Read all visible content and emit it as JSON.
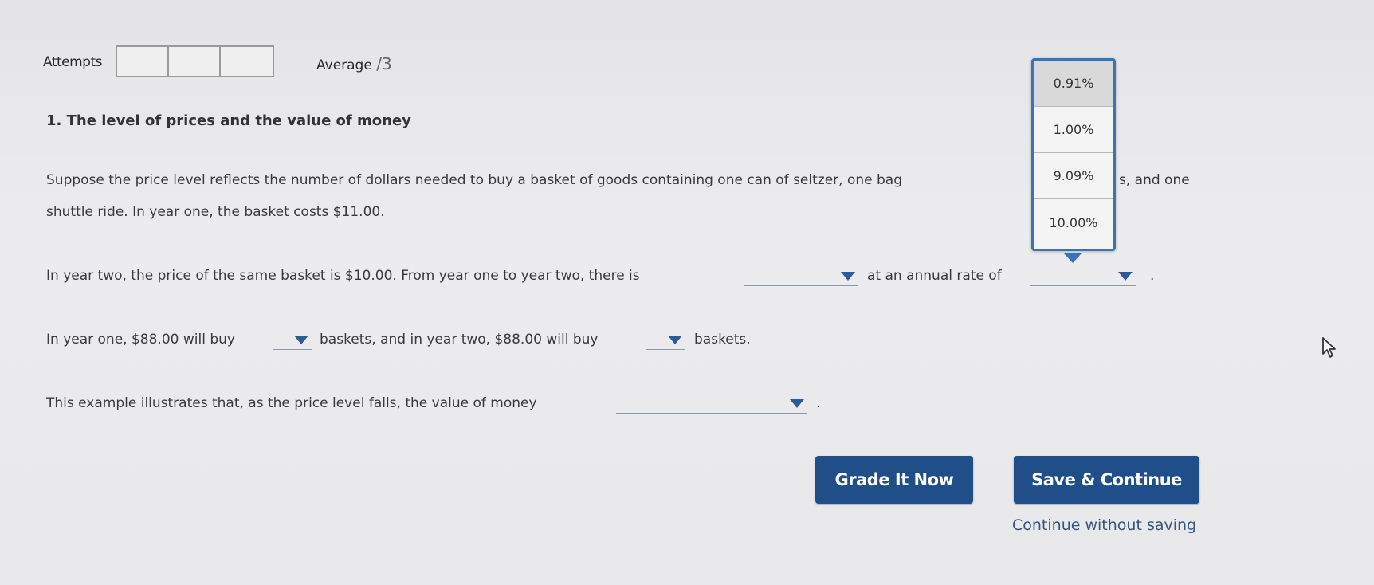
{
  "attempts": {
    "label": "Attempts",
    "box_count": 3
  },
  "average": {
    "label": "Average",
    "slash": "/",
    "value": "3"
  },
  "question": {
    "title": "1. The level of prices and the value of money",
    "intro_line1_a": "Suppose the price level reflects the number of dollars needed to buy a basket of goods containing one can of seltzer, one bag",
    "intro_line1_b": "s, and one",
    "intro_line2": "shuttle ride. In year one, the basket costs $11.00.",
    "year_two_text": "In year two, the price of the same basket is $10.00. From year one to year two, there is",
    "annual_rate_text": "at an annual rate of",
    "period": ".",
    "year_one_text": "In year one, $88.00 will buy",
    "baskets_year_two_text": "baskets, and in year two, $88.00 will buy",
    "baskets_end": "baskets.",
    "example_text": "This example illustrates that, as the price level falls, the value of money",
    "example_period": "."
  },
  "rate_dropdown": {
    "options": [
      "0.91%",
      "1.00%",
      "9.09%",
      "10.00%"
    ],
    "highlighted_index": 0
  },
  "buttons": {
    "grade": "Grade It Now",
    "save": "Save & Continue",
    "continue_link": "Continue without saving"
  },
  "colors": {
    "button_bg": "#1f4e88",
    "dropdown_border": "#3b73b8",
    "arrow": "#2d5b9a"
  }
}
